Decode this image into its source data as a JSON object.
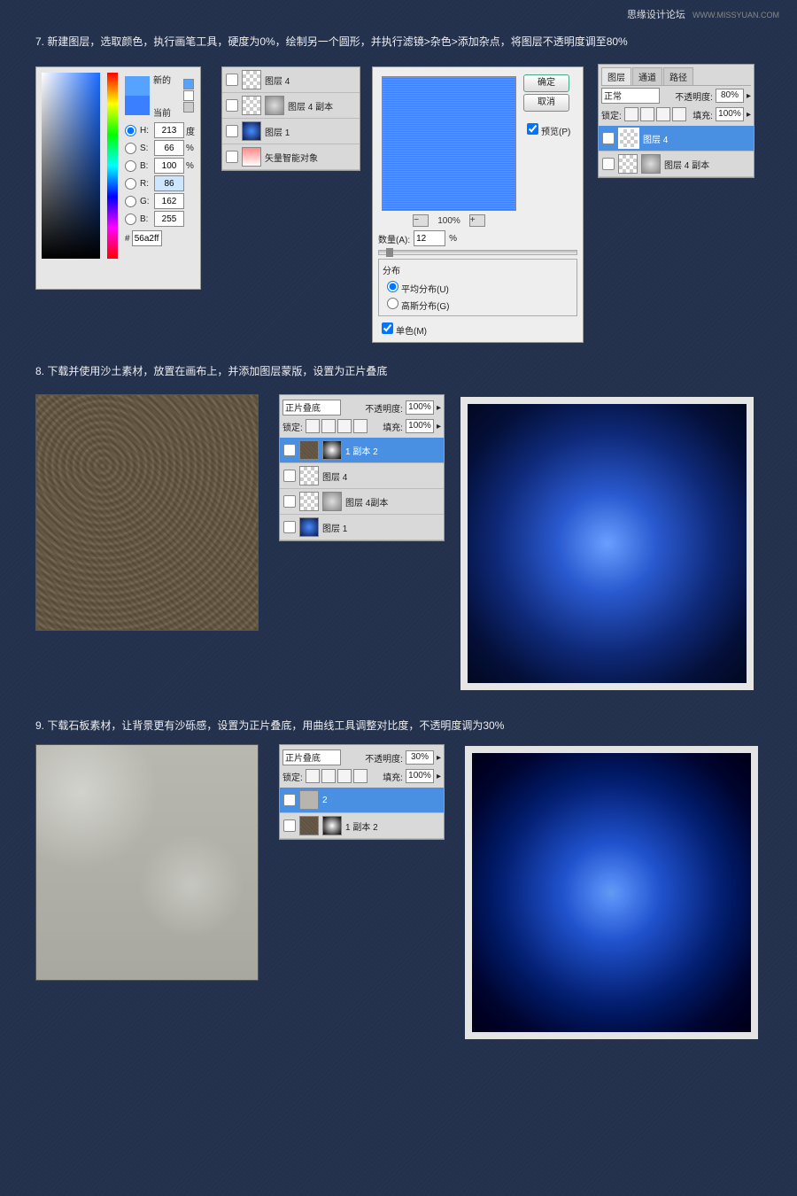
{
  "watermark": {
    "title": "思缘设计论坛",
    "url": "WWW.MISSYUAN.COM"
  },
  "step7": {
    "text": "7. 新建图层，选取颜色，执行画笔工具，硬度为0%，绘制另一个圆形，并执行滤镜>杂色>添加杂点，将图层不透明度调至80%"
  },
  "picker": {
    "new": "新的",
    "current": "当前",
    "h_lbl": "H:",
    "h": "213",
    "h_u": "度",
    "s_lbl": "S:",
    "s": "66",
    "s_u": "%",
    "b_lbl": "B:",
    "b": "100",
    "b_u": "%",
    "r_lbl": "R:",
    "r": "86",
    "g_lbl": "G:",
    "g": "162",
    "bl_lbl": "B:",
    "bl": "255",
    "hex_lbl": "#",
    "hex": "56a2ff",
    "new_color": "#56a2ff",
    "cur_color": "#3a7fff"
  },
  "lp7": {
    "rows": [
      {
        "name": "图层 4"
      },
      {
        "name": "图层 4 副本"
      },
      {
        "name": "图层 1"
      },
      {
        "name": "矢量智能对象"
      }
    ]
  },
  "noise": {
    "ok": "确定",
    "cancel": "取消",
    "preview": "预览(P)",
    "zoom": "100%",
    "amount_lbl": "数量(A):",
    "amount": "12",
    "amount_u": "%",
    "dist_title": "分布",
    "uniform": "平均分布(U)",
    "gaussian": "高斯分布(G)",
    "mono": "单色(M)"
  },
  "lp7b": {
    "tabs": [
      "图层",
      "通道",
      "路径"
    ],
    "blend": "正常",
    "opacity_lbl": "不透明度:",
    "opacity": "80%",
    "lock_lbl": "锁定:",
    "fill_lbl": "填充:",
    "fill": "100%",
    "rows": [
      {
        "name": "图层 4"
      },
      {
        "name": "图层 4 副本"
      }
    ]
  },
  "step8": {
    "text": "8. 下载并使用沙土素材，放置在画布上，并添加图层蒙版，设置为正片叠底"
  },
  "lp8": {
    "blend": "正片叠底",
    "opacity_lbl": "不透明度:",
    "opacity": "100%",
    "lock_lbl": "锁定:",
    "fill_lbl": "填充:",
    "fill": "100%",
    "rows": [
      {
        "name": "1 副本 2"
      },
      {
        "name": "图层 4"
      },
      {
        "name": "图层 4副本"
      },
      {
        "name": "图层 1"
      }
    ]
  },
  "step9": {
    "text": "9. 下载石板素材，让背景更有沙砾感，设置为正片叠底，用曲线工具调整对比度，不透明度调为30%"
  },
  "lp9": {
    "blend": "正片叠底",
    "opacity_lbl": "不透明度:",
    "opacity": "30%",
    "lock_lbl": "锁定:",
    "fill_lbl": "填充:",
    "fill": "100%",
    "rows": [
      {
        "name": "2"
      },
      {
        "name": "1 副本 2"
      }
    ]
  }
}
